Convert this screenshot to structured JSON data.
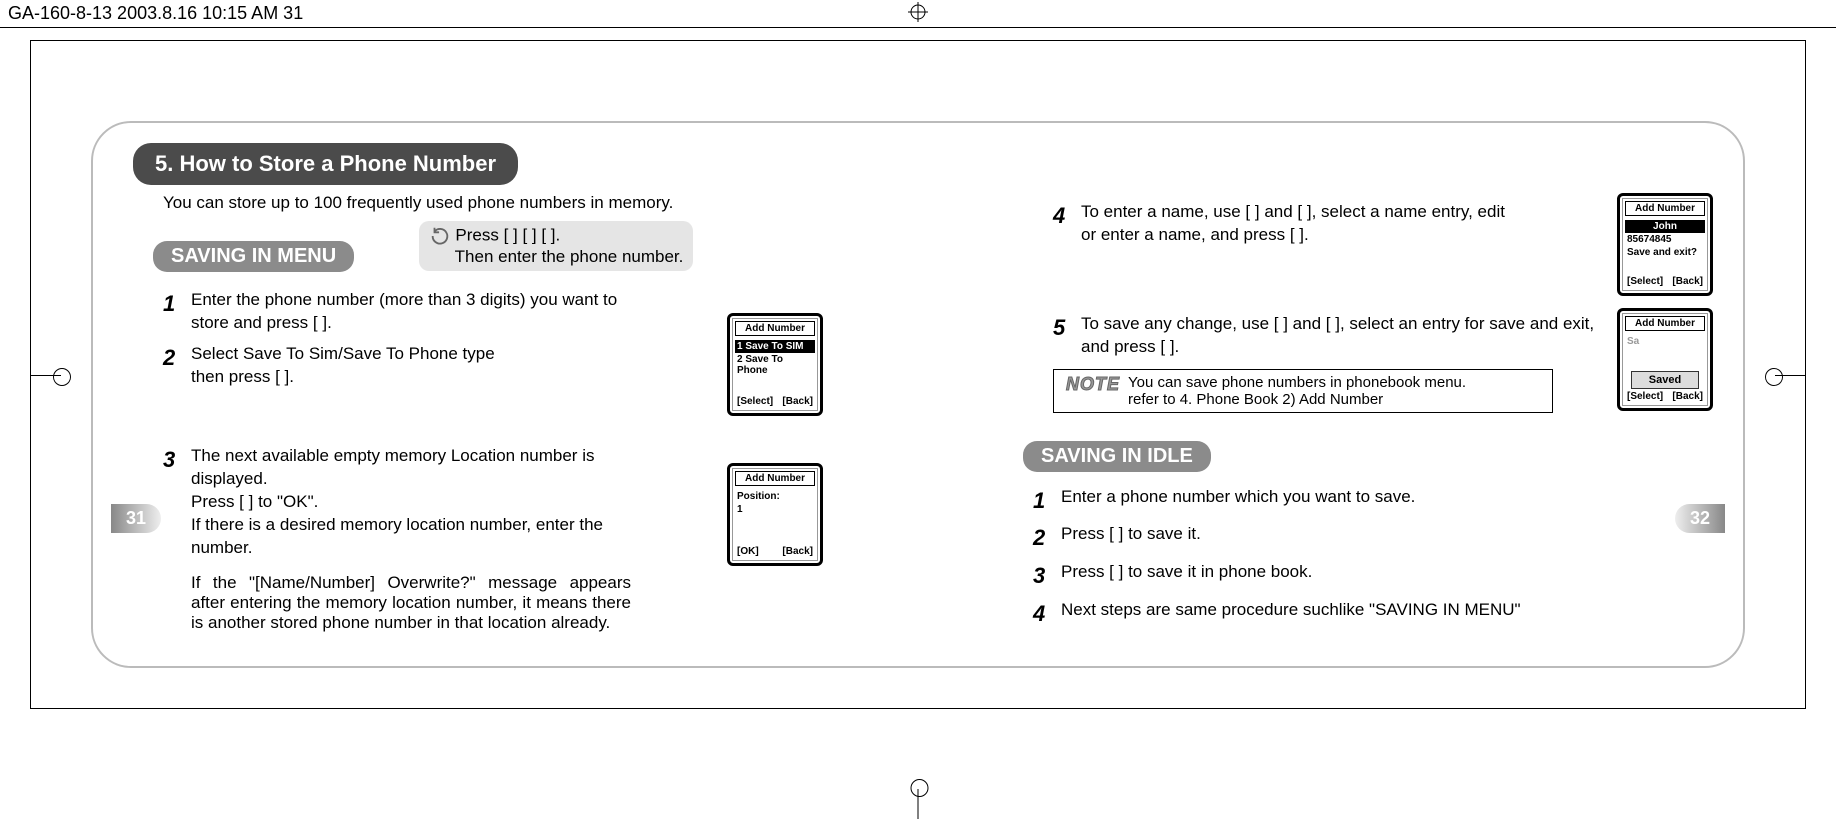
{
  "header": {
    "text": "GA-160-8-13      2003.8.16 10:15 AM      31"
  },
  "page_left": "31",
  "page_right": "32",
  "section_title": "5. How to Store a Phone Number",
  "intro": "You can store up to 100 frequently used phone numbers in memory.",
  "sub_saving_menu": "SAVING IN MENU",
  "press_line1": "Press [      ] [      ] [      ].",
  "press_line2": "Then enter the phone number.",
  "left_steps": {
    "s1": "Enter the phone number (more than 3 digits) you want to store  and press [      ].",
    "s2a": "Select Save To Sim/Save To Phone type",
    "s2b": "then press [      ].",
    "s3a": "The next available empty memory Location number is displayed.",
    "s3b": "Press [      ] to \"OK\".",
    "s3c": "If there is a desired memory location number, enter the number.",
    "s3_para": "If the \"[Name/Number] Overwrite?\" message appears after entering the memory location number, it means there is another stored phone number in that location already."
  },
  "right_steps": {
    "s4": "To enter a name, use [       ] and [       ], select a name entry, edit or enter a name, and press [       ].",
    "s5": "To save any change, use [       ] and [       ], select an entry for save and exit, and press [       ]."
  },
  "note": {
    "label": "NOTE",
    "line1": "You can save phone numbers in phonebook menu.",
    "line2": "refer to 4. Phone Book      2) Add Number"
  },
  "sub_saving_idle": "SAVING IN IDLE",
  "idle_steps": {
    "s1": "Enter a phone number which you want to save.",
    "s2": "Press [      ] to save it.",
    "s3": "Press [      ] to save it in phone book.",
    "s4": "Next steps are same procedure suchlike \"SAVING IN MENU\""
  },
  "phone_a": {
    "title": "Add Number",
    "l1": "1 Save To SIM",
    "l2": "2 Save To Phone",
    "sk_l": "[Select]",
    "sk_r": "[Back]"
  },
  "phone_b": {
    "title": "Add Number",
    "l1": "Position:",
    "l2": "1",
    "sk_l": "[OK]",
    "sk_r": "[Back]"
  },
  "phone_c": {
    "title": "Add Number",
    "l1": "John",
    "l2": "85674845",
    "l3": "Save and exit?",
    "sk_l": "[Select]",
    "sk_r": "[Back]"
  },
  "phone_d": {
    "title": "Add Number",
    "popup": "Saved",
    "sk_l": "[Select]",
    "sk_r": "[Back]"
  }
}
